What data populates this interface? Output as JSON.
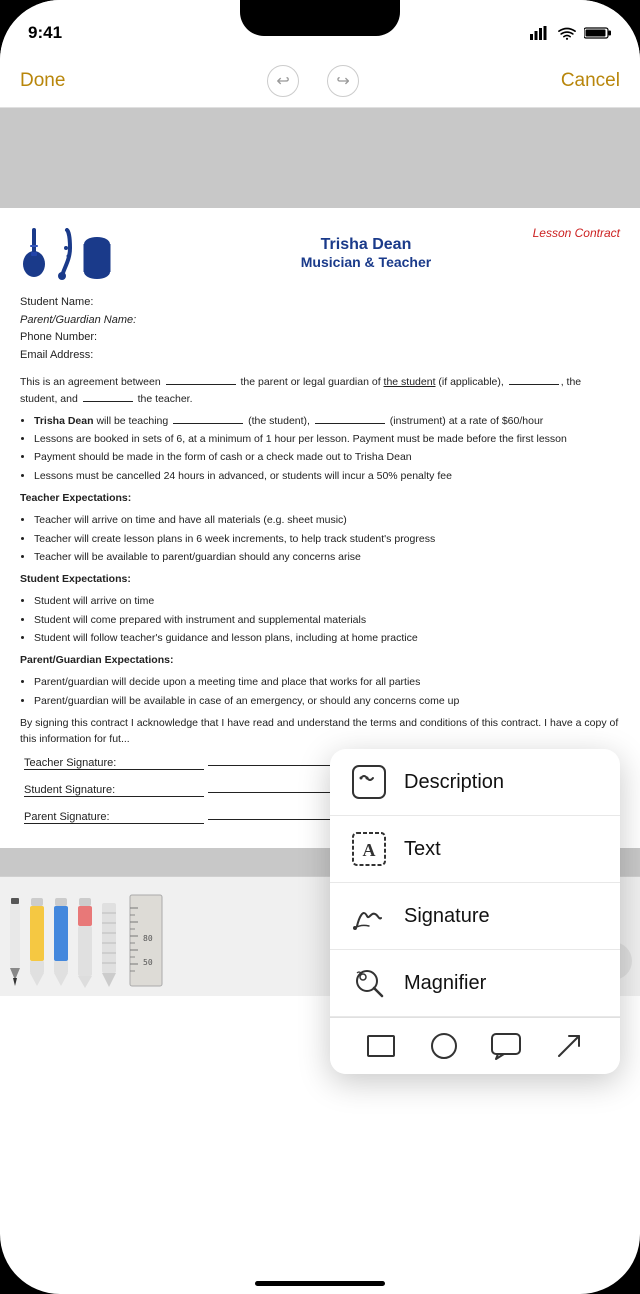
{
  "status": {
    "time": "9:41",
    "signal_label": "signal",
    "wifi_label": "wifi",
    "battery_label": "battery"
  },
  "toolbar": {
    "done_label": "Done",
    "cancel_label": "Cancel",
    "undo_label": "undo",
    "redo_label": "redo"
  },
  "document": {
    "header": {
      "name": "Trisha Dean",
      "subtitle": "Musician & Teacher",
      "label": "Lesson Contract"
    },
    "fields": {
      "student_name": "Student Name:",
      "guardian_name": "Parent/Guardian Name:",
      "phone": "Phone Number:",
      "email": "Email Address:"
    },
    "body": {
      "agreement": "This is an agreement between",
      "agreement_mid1": "the parent or legal guardian of",
      "agreement_mid2": "the student",
      "agreement_mid3": "(if applicable),",
      "agreement_mid4": "the student, and",
      "agreement_mid5": "the teacher.",
      "bullet1": "Trisha Dean will be teaching",
      "bullet1b": "(the student),",
      "bullet1c": "(instrument) at a rate of $60/hour",
      "bullet2": "Lessons are booked in sets of 6, at a minimum of 1 hour per lesson. Payment must be made before the first lesson",
      "bullet3": "Payment should be made in the form of cash or a check made out to Trisha Dean",
      "bullet4": "Lessons must be cancelled 24 hours in advanced, or students will incur a 50% penalty fee",
      "teacher_heading": "Teacher Expectations:",
      "teacher_b1": "Teacher will arrive on time and have all materials (e.g. sheet music)",
      "teacher_b2": "Teacher will create lesson plans in 6 week increments, to help track student's progress",
      "teacher_b3": "Teacher will be available to parent/guardian should any concerns arise",
      "student_heading": "Student Expectations:",
      "student_b1": "Student will arrive on time",
      "student_b2": "Student will come prepared with instrument and supplemental materials",
      "student_b3": "Student will follow teacher's guidance and lesson plans, including at home practice",
      "parent_heading": "Parent/Guardian Expectations:",
      "parent_b1": "Parent/guardian will decide upon a meeting time and place that works for all parties",
      "parent_b2": "Parent/guardian will be available in case of an emergency, or should any concerns come up",
      "signing": "By signing this contract I acknowledge that I have read and understand the terms and conditions of this contract. I have a copy of this information for fut..."
    },
    "signatures": {
      "teacher": "Teacher Signature:",
      "student": "Student Signature:",
      "parent": "Parent Signature:"
    }
  },
  "popup": {
    "items": [
      {
        "id": "description",
        "label": "Description",
        "icon": "description-icon"
      },
      {
        "id": "text",
        "label": "Text",
        "icon": "text-icon"
      },
      {
        "id": "signature",
        "label": "Signature",
        "icon": "signature-icon"
      },
      {
        "id": "magnifier",
        "label": "Magnifier",
        "icon": "magnifier-icon"
      }
    ],
    "shapes": [
      {
        "id": "rectangle",
        "label": "rectangle-icon"
      },
      {
        "id": "circle",
        "label": "circle-icon"
      },
      {
        "id": "speech",
        "label": "speech-icon"
      },
      {
        "id": "arrow",
        "label": "arrow-icon"
      }
    ]
  },
  "drawing_tools": {
    "ruler_number": "80",
    "ruler_number2": "50"
  }
}
